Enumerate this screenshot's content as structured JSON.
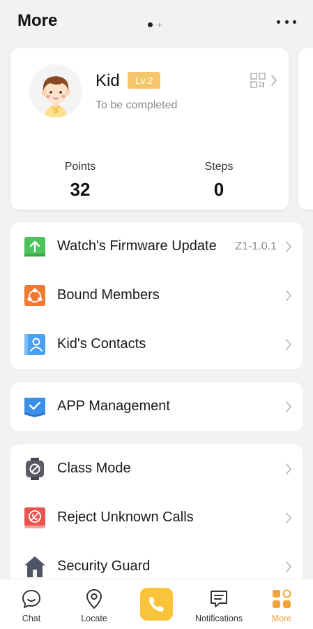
{
  "header": {
    "title": "More"
  },
  "profile": {
    "name": "Kid",
    "level": "Lv.2",
    "status": "To be completed",
    "stats": {
      "points_label": "Points",
      "points_value": "32",
      "steps_label": "Steps",
      "steps_value": "0"
    }
  },
  "group1": [
    {
      "label": "Watch's Firmware Update",
      "value": "Z1-1.0.1",
      "icon": "firmware-update-icon",
      "color": "#4cc35b"
    },
    {
      "label": "Bound Members",
      "icon": "bound-members-icon",
      "color": "#f07a2f"
    },
    {
      "label": "Kid's Contacts",
      "icon": "contacts-icon",
      "color": "#4a9ff0"
    }
  ],
  "group2": [
    {
      "label": "APP Management",
      "icon": "app-management-icon",
      "color": "#3a8fe8"
    }
  ],
  "group3": [
    {
      "label": "Class Mode",
      "icon": "class-mode-icon",
      "color": "#5b5b66"
    },
    {
      "label": "Reject Unknown Calls",
      "icon": "reject-calls-icon",
      "color": "#e8554f"
    },
    {
      "label": "Security Guard",
      "icon": "security-guard-icon",
      "color": "#4f5566"
    }
  ],
  "tabbar": {
    "chat": "Chat",
    "locate": "Locate",
    "notifications": "Notifications",
    "more": "More",
    "active": "More"
  },
  "colors": {
    "accent": "#f2a33a",
    "call_button": "#f9c33b",
    "level_badge": "#f5c76a"
  }
}
